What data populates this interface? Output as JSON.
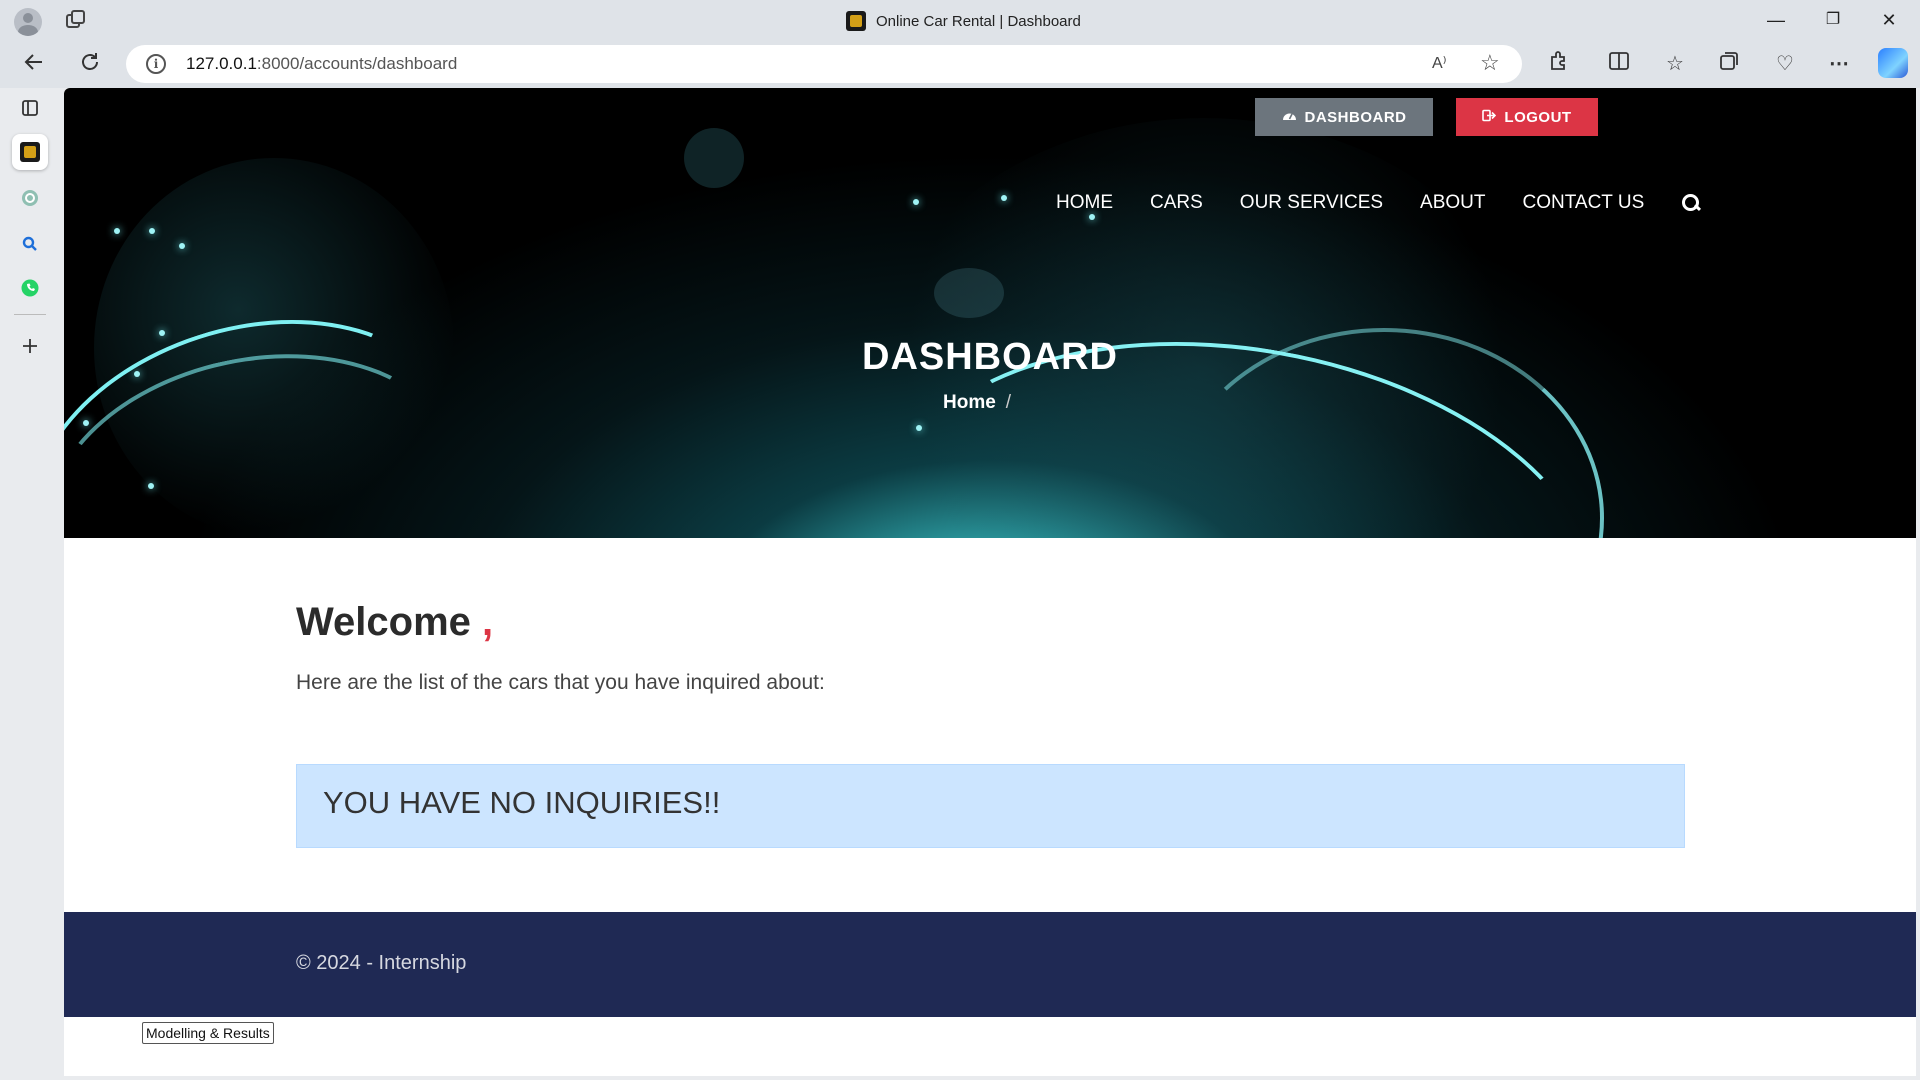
{
  "browser": {
    "tab_title": "Online Car Rental | Dashboard",
    "url_host": "127.0.0.1",
    "url_path": ":8000/accounts/dashboard",
    "read_aloud": "A⁾",
    "window_controls": {
      "minimize": "—",
      "restore": "❐",
      "close": "✕"
    },
    "icons": [
      "profile-icon",
      "tab-actions-icon",
      "back-icon",
      "refresh-icon",
      "site-info-icon",
      "read-aloud-icon",
      "favorite-star-icon",
      "extensions-icon",
      "split-screen-icon",
      "favorites-icon",
      "collections-icon",
      "browser-essentials-icon",
      "more-icon",
      "copilot-icon"
    ]
  },
  "sidebar": {
    "icons": [
      "tab-list-icon",
      "site-favicon-icon",
      "chatgpt-icon",
      "search-icon",
      "whatsapp-icon",
      "add-icon"
    ]
  },
  "header": {
    "dashboard_button": "DASHBOARD",
    "logout_button": "LOGOUT",
    "nav": [
      "HOME",
      "CARS",
      "OUR SERVICES",
      "ABOUT",
      "CONTACT US"
    ]
  },
  "hero": {
    "title": "DASHBOARD",
    "breadcrumb_home": "Home",
    "breadcrumb_sep": "/"
  },
  "main": {
    "welcome": "Welcome",
    "welcome_comma": ",",
    "subtitle": "Here are the list of the cars that you have inquired about:",
    "alert": "YOU HAVE NO INQUIRIES!!"
  },
  "footer": {
    "text": "© 2024 - Internship"
  },
  "tooltip": "Modelling & Results",
  "colors": {
    "dashboard_btn": "#6c757d",
    "logout_btn": "#dc3545",
    "alert_bg": "#cce5ff",
    "footer_bg": "#1f2954",
    "accent_comma": "#dc3545"
  }
}
